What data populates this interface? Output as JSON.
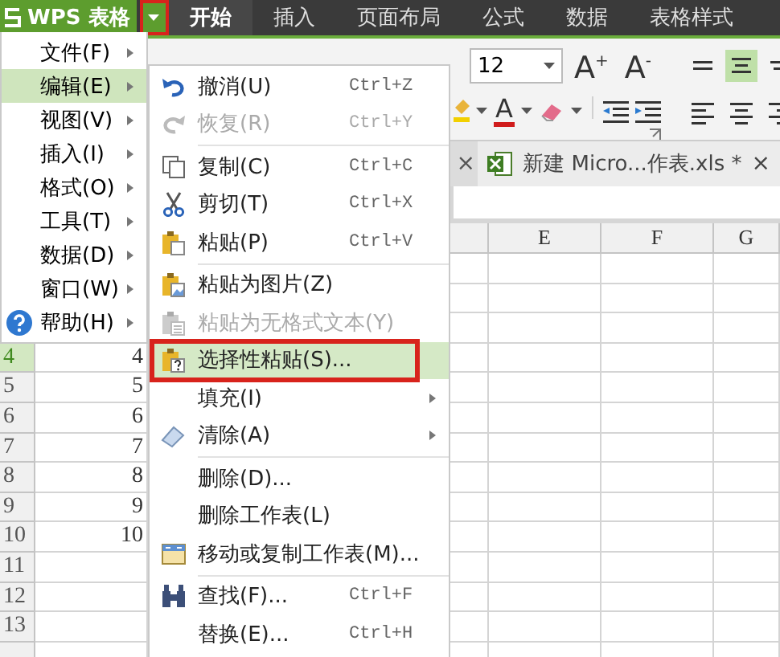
{
  "title_bar": {
    "app_button": "WPS 表格",
    "tabs": [
      {
        "label": "开始",
        "selected": true
      },
      {
        "label": "插入",
        "selected": false
      },
      {
        "label": "页面布局",
        "selected": false
      },
      {
        "label": "公式",
        "selected": false
      },
      {
        "label": "数据",
        "selected": false
      },
      {
        "label": "表格样式",
        "selected": false
      }
    ]
  },
  "toolbar": {
    "font_size": "12",
    "font_grow": "A$^{+}$",
    "font_shrink": "A$^{-}$",
    "font_color": "A",
    "align_buttons": [
      {
        "selected": false
      },
      {
        "selected": true
      },
      {
        "selected": false
      }
    ]
  },
  "document_tabs": [
    {
      "close": "×"
    },
    {
      "title": "新建 Micro...作表.xls *",
      "close": "×"
    }
  ],
  "sheet": {
    "column_headers": [
      "E",
      "F",
      "G"
    ],
    "rows": [
      {
        "number": "4",
        "a": "4",
        "selected": true
      },
      {
        "number": "5",
        "a": "5",
        "selected": false
      },
      {
        "number": "6",
        "a": "6",
        "selected": false
      },
      {
        "number": "7",
        "a": "7",
        "selected": false
      },
      {
        "number": "8",
        "a": "8",
        "selected": false
      },
      {
        "number": "9",
        "a": "9",
        "selected": false
      },
      {
        "number": "10",
        "a": "10",
        "selected": false
      },
      {
        "number": "11",
        "selected": false
      },
      {
        "number": "12",
        "selected": false
      },
      {
        "number": "13",
        "selected": false
      }
    ]
  },
  "main_menu": {
    "items": [
      {
        "label": "文件(F)",
        "selected": false
      },
      {
        "label": "编辑(E)",
        "selected": true
      },
      {
        "label": "视图(V)",
        "selected": false
      },
      {
        "label": "插入(I)",
        "selected": false
      },
      {
        "label": "格式(O)",
        "selected": false
      },
      {
        "label": "工具(T)",
        "selected": false
      },
      {
        "label": "数据(D)",
        "selected": false
      },
      {
        "label": "窗口(W)",
        "selected": false
      },
      {
        "label": "帮助(H)",
        "selected": false
      }
    ]
  },
  "edit_menu": {
    "items": [
      {
        "kind": "item",
        "label": "撤消(U)",
        "shortcut": "Ctrl+Z",
        "disabled": false,
        "selected": false,
        "submenu": false
      },
      {
        "kind": "item",
        "label": "恢复(R)",
        "shortcut": "Ctrl+Y",
        "disabled": true,
        "selected": false,
        "submenu": false
      },
      {
        "kind": "separator"
      },
      {
        "kind": "item",
        "label": "复制(C)",
        "shortcut": "Ctrl+C",
        "disabled": false,
        "selected": false,
        "submenu": false
      },
      {
        "kind": "item",
        "label": "剪切(T)",
        "shortcut": "Ctrl+X",
        "disabled": false,
        "selected": false,
        "submenu": false
      },
      {
        "kind": "item",
        "label": "粘贴(P)",
        "shortcut": "Ctrl+V",
        "disabled": false,
        "selected": false,
        "submenu": false
      },
      {
        "kind": "separator"
      },
      {
        "kind": "item",
        "label": "粘贴为图片(Z)",
        "disabled": false,
        "selected": false,
        "submenu": false
      },
      {
        "kind": "item",
        "label": "粘贴为无格式文本(Y)",
        "disabled": true,
        "selected": false,
        "submenu": false
      },
      {
        "kind": "item",
        "label": "选择性粘贴(S)...",
        "disabled": false,
        "selected": true,
        "submenu": false
      },
      {
        "kind": "item",
        "label": "填充(I)",
        "disabled": false,
        "selected": false,
        "submenu": true
      },
      {
        "kind": "item",
        "label": "清除(A)",
        "disabled": false,
        "selected": false,
        "submenu": true
      },
      {
        "kind": "separator"
      },
      {
        "kind": "item",
        "label": "删除(D)...",
        "disabled": false,
        "selected": false,
        "submenu": false
      },
      {
        "kind": "item",
        "label": "删除工作表(L)",
        "disabled": false,
        "selected": false,
        "submenu": false
      },
      {
        "kind": "item",
        "label": "移动或复制工作表(M)...",
        "disabled": false,
        "selected": false,
        "submenu": false
      },
      {
        "kind": "separator"
      },
      {
        "kind": "item",
        "label": "查找(F)...",
        "shortcut": "Ctrl+F",
        "disabled": false,
        "selected": false,
        "submenu": false
      },
      {
        "kind": "item",
        "label": "替换(E)...",
        "shortcut": "Ctrl+H",
        "disabled": false,
        "selected": false,
        "submenu": false
      }
    ]
  }
}
